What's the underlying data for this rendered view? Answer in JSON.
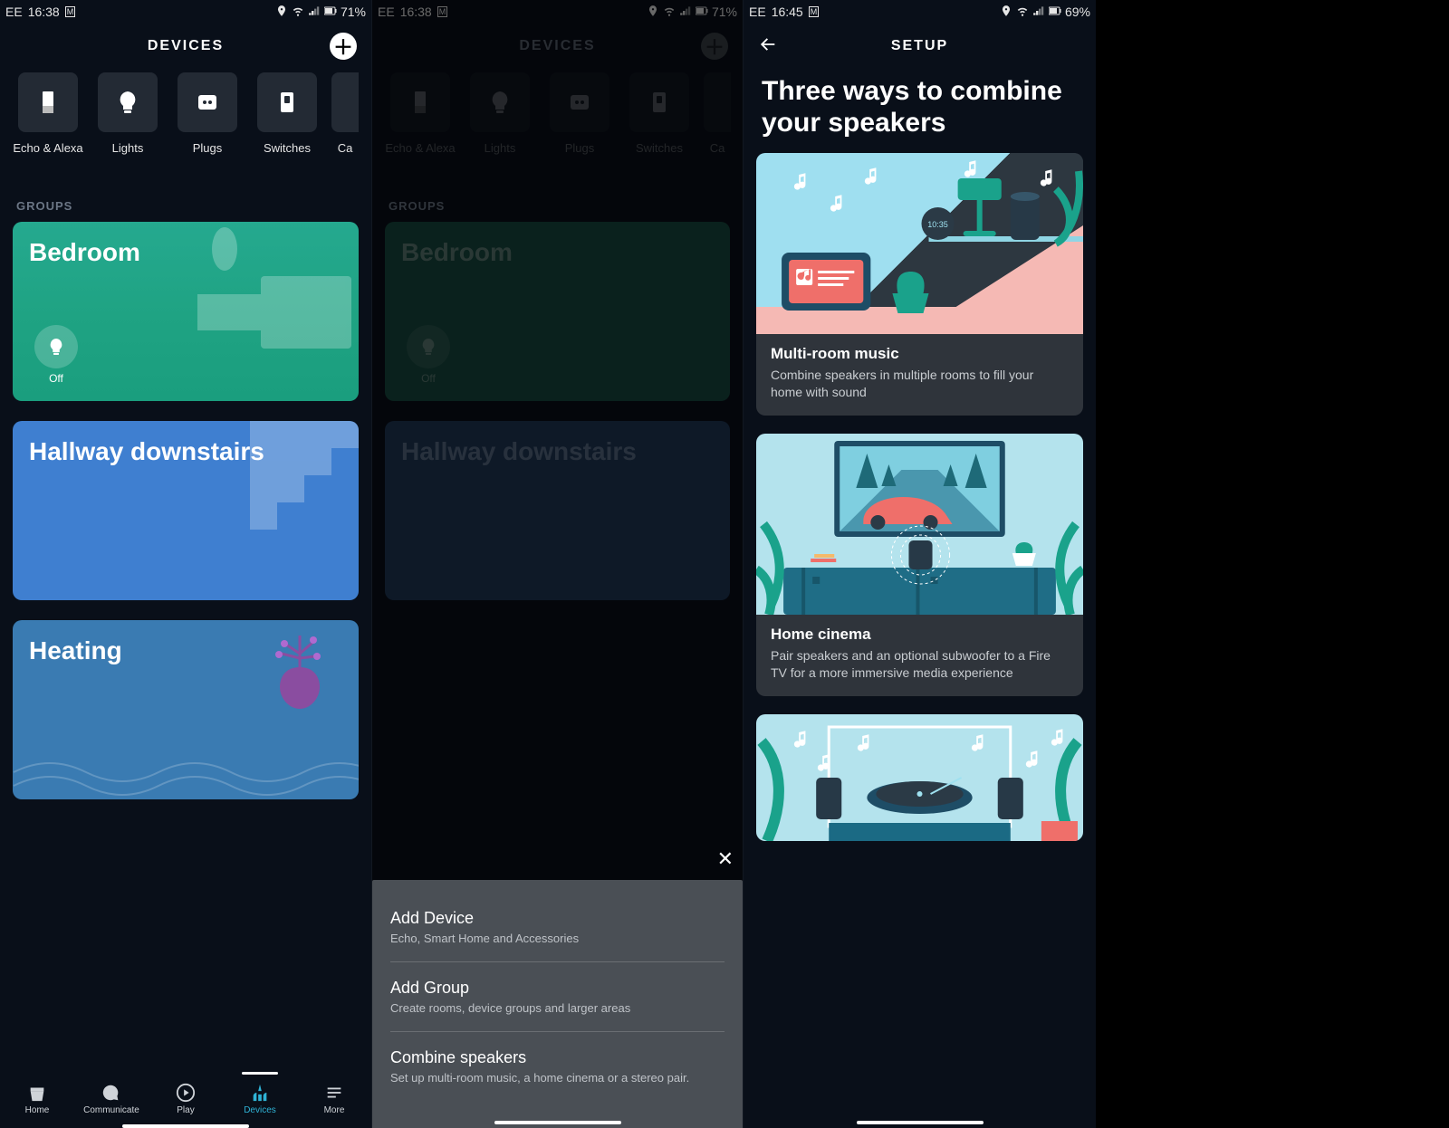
{
  "screen1": {
    "status": {
      "carrier": "EE",
      "time": "16:38",
      "battery": "71%"
    },
    "header": {
      "title": "DEVICES"
    },
    "categories": [
      {
        "label": "Echo & Alexa",
        "icon": "echo"
      },
      {
        "label": "Lights",
        "icon": "bulb"
      },
      {
        "label": "Plugs",
        "icon": "plug"
      },
      {
        "label": "Switches",
        "icon": "switch"
      },
      {
        "label": "Ca",
        "icon": "camera"
      }
    ],
    "section_label": "GROUPS",
    "groups": [
      {
        "name": "Bedroom",
        "device": {
          "icon": "bulb",
          "label": "Off"
        },
        "theme": "bedroom"
      },
      {
        "name": "Hallway downstairs",
        "theme": "hallway"
      },
      {
        "name": "Heating",
        "theme": "heating"
      }
    ],
    "nav": [
      {
        "label": "Home",
        "icon": "home"
      },
      {
        "label": "Communicate",
        "icon": "chat"
      },
      {
        "label": "Play",
        "icon": "play"
      },
      {
        "label": "Devices",
        "icon": "devices",
        "active": true
      },
      {
        "label": "More",
        "icon": "more"
      }
    ]
  },
  "screen2": {
    "status": {
      "carrier": "EE",
      "time": "16:38",
      "battery": "71%"
    },
    "header": {
      "title": "DEVICES"
    },
    "section_label": "GROUPS",
    "groups": {
      "bedroom": "Bedroom",
      "bedroom_off": "Off",
      "hallway": "Hallway downstairs"
    },
    "sheet": {
      "items": [
        {
          "title": "Add Device",
          "sub": "Echo, Smart Home and Accessories"
        },
        {
          "title": "Add Group",
          "sub": "Create rooms, device groups and larger areas"
        },
        {
          "title": "Combine speakers",
          "sub": "Set up multi-room music, a home cinema or a stereo pair."
        }
      ]
    }
  },
  "screen3": {
    "status": {
      "carrier": "EE",
      "time": "16:45",
      "battery": "69%"
    },
    "header": {
      "title": "SETUP"
    },
    "heading": "Three ways to combine your speakers",
    "options": [
      {
        "title": "Multi-room music",
        "desc": "Combine speakers in multiple rooms to fill your home with sound"
      },
      {
        "title": "Home cinema",
        "desc": "Pair speakers and an optional subwoofer to a Fire TV for a more immersive media experience"
      }
    ]
  }
}
